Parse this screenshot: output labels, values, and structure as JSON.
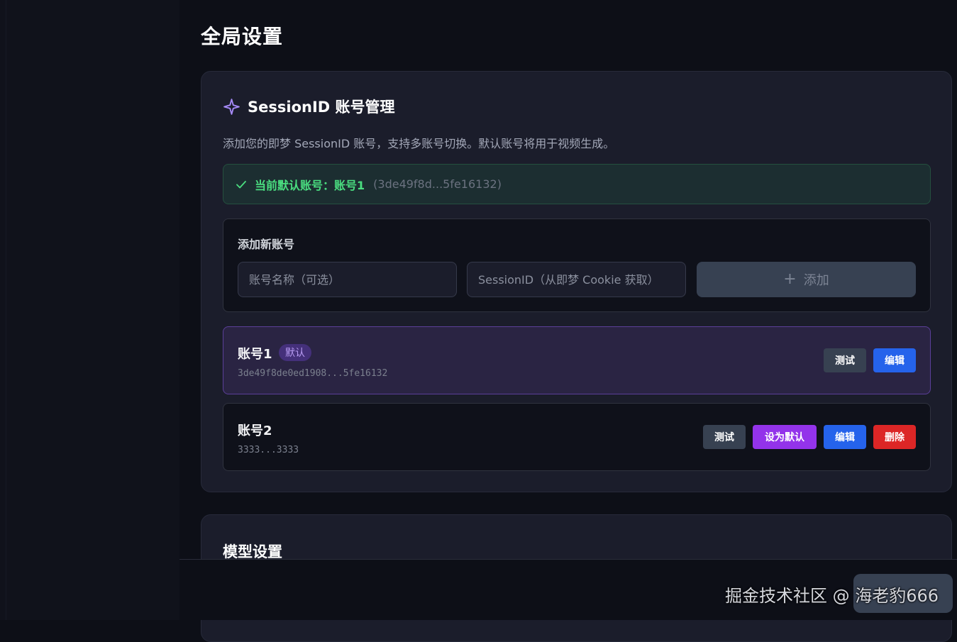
{
  "page": {
    "title": "全局设置"
  },
  "session_card": {
    "title": "SessionID 账号管理",
    "icon": "sparkle-icon",
    "description": "添加您的即梦 SessionID 账号，支持多账号切换。默认账号将用于视频生成。",
    "default_banner": {
      "label": "当前默认账号：账号1",
      "id_preview": "(3de49f8d...5fe16132)"
    },
    "add_form": {
      "title": "添加新账号",
      "name_placeholder": "账号名称（可选）",
      "sessionid_placeholder": "SessionID（从即梦 Cookie 获取）",
      "add_button_plus": "+",
      "add_button_label": "添加"
    },
    "accounts": [
      {
        "name": "账号1",
        "tag": "默认",
        "id": "3de49f8de0ed1908...5fe16132",
        "test_label": "测试",
        "edit_label": "编辑"
      },
      {
        "name": "账号2",
        "id": "3333...3333",
        "test_label": "测试",
        "set_default_label": "设为默认",
        "edit_label": "编辑",
        "delete_label": "删除"
      }
    ]
  },
  "model_card": {
    "title": "模型设置"
  },
  "watermark": "掘金技术社区 @ 海老豹666",
  "colors": {
    "accent_purple": "#9333ea",
    "accent_blue": "#2563eb",
    "danger_red": "#dc2626",
    "success_green": "#4ade80"
  }
}
